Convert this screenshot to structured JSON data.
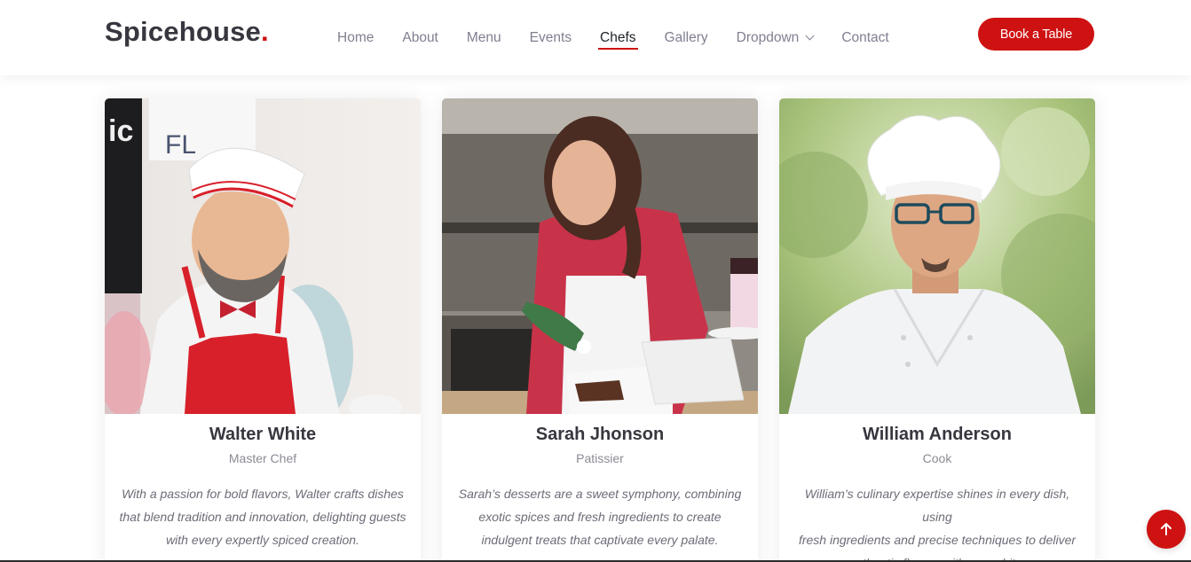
{
  "brand": {
    "name": "Spicehouse",
    "dot": ".",
    "accent_color": "#ce1212"
  },
  "nav": {
    "items": [
      {
        "label": "Home"
      },
      {
        "label": "About"
      },
      {
        "label": "Menu"
      },
      {
        "label": "Events"
      },
      {
        "label": "Chefs",
        "active": true
      },
      {
        "label": "Gallery"
      },
      {
        "label": "Dropdown",
        "icon": "chevron-down-icon"
      },
      {
        "label": "Contact"
      }
    ],
    "cta_label": "Book a Table"
  },
  "chefs": [
    {
      "name": "Walter White",
      "role": "Master Chef",
      "bio_lines": [
        "With a passion for bold flavors, Walter crafts dishes",
        "that blend tradition and innovation, delighting guests",
        "with every expertly spiced creation."
      ]
    },
    {
      "name": "Sarah Jhonson",
      "role": "Patissier",
      "bio_lines": [
        "Sarah’s desserts are a sweet symphony, combining",
        "exotic spices and fresh ingredients to create",
        "indulgent treats that captivate every palate."
      ]
    },
    {
      "name": "William Anderson",
      "role": "Cook",
      "bio_lines": [
        "William’s culinary expertise shines in every dish, using",
        "fresh ingredients and precise techniques to deliver",
        "authentic flavors with every bite."
      ]
    }
  ],
  "scroll_top": {
    "icon": "arrow-up-icon"
  }
}
